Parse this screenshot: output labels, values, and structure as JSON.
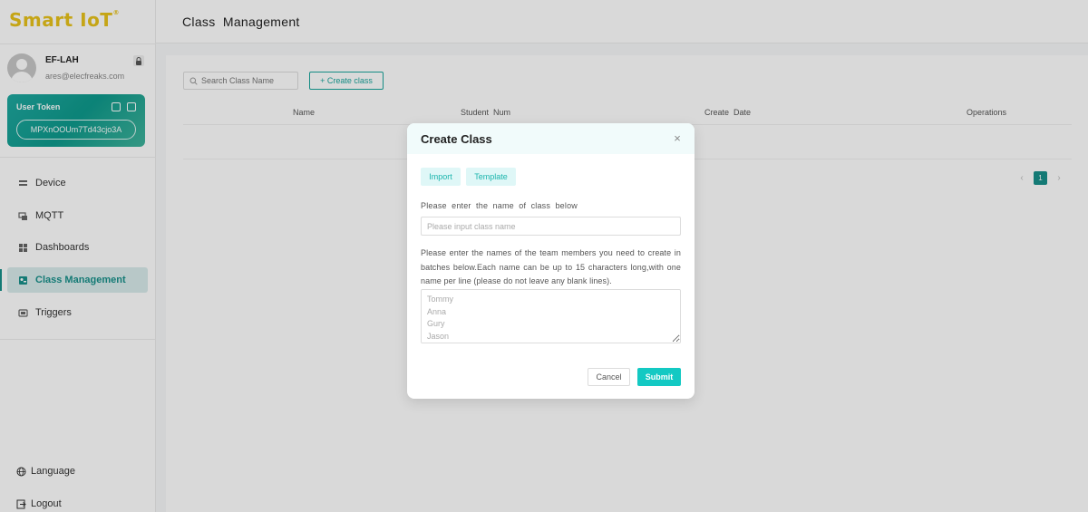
{
  "sidebar": {
    "logo_text": "Smart IoT",
    "user": {
      "name": "EF-LAH",
      "email": "ares@elecfreaks.com"
    },
    "token": {
      "title": "User Token",
      "value": "MPXnOOUm7Td43cjo3A"
    },
    "nav": [
      {
        "label": "Device",
        "icon": "device-icon"
      },
      {
        "label": "MQTT",
        "icon": "mqtt-icon"
      },
      {
        "label": "Dashboards",
        "icon": "dashboards-icon"
      },
      {
        "label": "Class Management",
        "icon": "class-icon",
        "active": true
      },
      {
        "label": "Triggers",
        "icon": "triggers-icon"
      }
    ],
    "language_label": "Language",
    "logout_label": "Logout"
  },
  "header": {
    "title": "Class  Management"
  },
  "main": {
    "search_placeholder": "Search Class Name",
    "create_label": "+ Create class",
    "table_headers": [
      "Name",
      "Student  Num",
      "Create  Date",
      "Operations"
    ],
    "pagination": {
      "current": "1",
      "prev": "‹",
      "next": "›"
    }
  },
  "modal": {
    "title": "Create Class",
    "close": "×",
    "tabs": [
      "Import",
      "Template"
    ],
    "class_label": "Please  enter  the  name  of  class  below",
    "class_placeholder": "Please input class name",
    "members_desc": "Please enter the names of the team members you need to create in batches below.Each name can be up to 15 characters long,with one name per line (please do not leave any blank lines).",
    "members_placeholder": "Tommy\nAnna\nGury\nJason",
    "cancel_label": "Cancel",
    "submit_label": "Submit"
  },
  "colors": {
    "accent": "#18908a",
    "submit": "#13c9c3",
    "logo": "#e8c21a"
  }
}
